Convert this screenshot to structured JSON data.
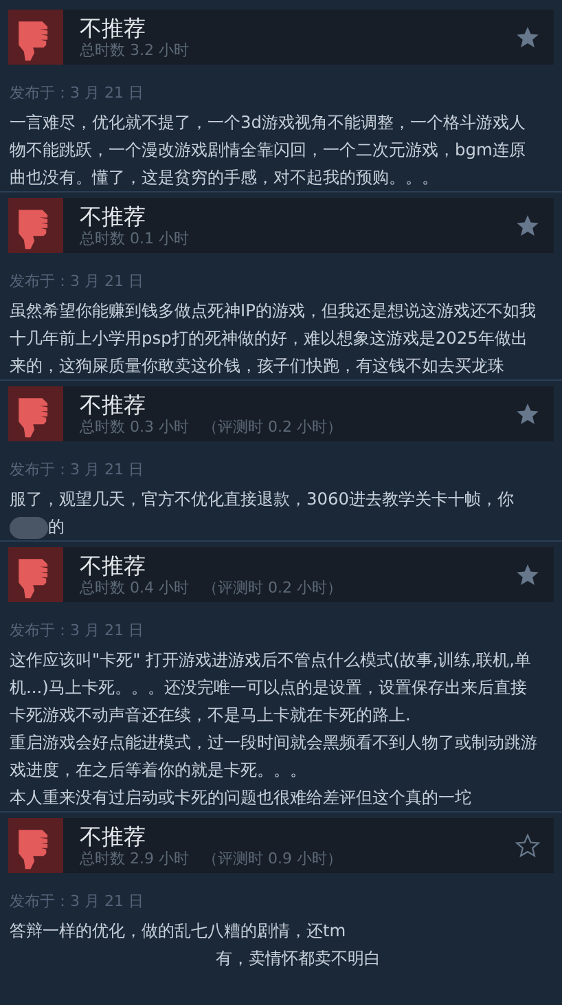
{
  "reviews": [
    {
      "verdict": "不推荐",
      "hours": "总时数 3.2 小时",
      "favorite": true,
      "posted": "发布于：3 月 21 日",
      "body": [
        [
          {
            "kind": "text",
            "text": "一言难尽，优化就不提了，一个3d游戏视角不能调整，一个格斗游戏人物不能跳跃，一个漫改游戏剧情全靠闪回，一个二次元游戏，bgm连原曲也没有。懂了，这是贫穷的手感，对不起我的预购。。。"
          }
        ]
      ]
    },
    {
      "verdict": "不推荐",
      "hours": "总时数 0.1 小时",
      "favorite": true,
      "posted": "发布于：3 月 21 日",
      "body": [
        [
          {
            "kind": "text",
            "text": "虽然希望你能赚到钱多做点死神IP的游戏，但我还是想说这游戏还不如我十几年前上小学用psp打的死神做的好，难以想象这游戏是2025年做出来的，这狗屎质量你敢卖这价钱，孩子们快跑，有这钱不如去买龙珠"
          }
        ]
      ]
    },
    {
      "verdict": "不推荐",
      "hours": "总时数 0.3 小时",
      "review_hours": "（评测时 0.2 小时）",
      "favorite": true,
      "posted": "发布于：3 月 21 日",
      "body": [
        [
          {
            "kind": "text",
            "text": "服了，观望几天，官方不优化直接退款，3060进去教学关卡十帧，你"
          },
          {
            "kind": "blurred"
          },
          {
            "kind": "text",
            "text": "的"
          }
        ]
      ]
    },
    {
      "verdict": "不推荐",
      "hours": "总时数 0.4 小时",
      "review_hours": "（评测时 0.2 小时）",
      "favorite": true,
      "posted": "发布于：3 月 21 日",
      "body": [
        [
          {
            "kind": "text",
            "text": "这作应该叫\"卡死\" 打开游戏进游戏后不管点什么模式(故事,训练,联机,单机...)马上卡死。。。还没完唯一可以点的是设置，设置保存出来后直接卡死游戏不动声音还在续，不是马上卡就在卡死的路上."
          }
        ],
        [
          {
            "kind": "text",
            "text": "重启游戏会好点能进模式，过一段时间就会黑频看不到人物了或制动跳游戏进度，在之后等着你的就是卡死。。。"
          }
        ],
        [
          {
            "kind": "text",
            "text": "本人重来没有过启动或卡死的问题也很难给差评但这个真的一坨"
          }
        ]
      ]
    },
    {
      "verdict": "不推荐",
      "hours": "总时数 2.9 小时",
      "review_hours": "（评测时 0.9 小时）",
      "favorite": false,
      "posted": "发布于：3 月 21 日",
      "body": [
        [
          {
            "kind": "text",
            "text": "答辩一样的优化，做的乱七八糟的剧情，还tm"
          },
          {
            "kind": "gap"
          },
          {
            "kind": "text",
            "text": "有，卖情怀都卖不明白"
          }
        ]
      ]
    }
  ]
}
